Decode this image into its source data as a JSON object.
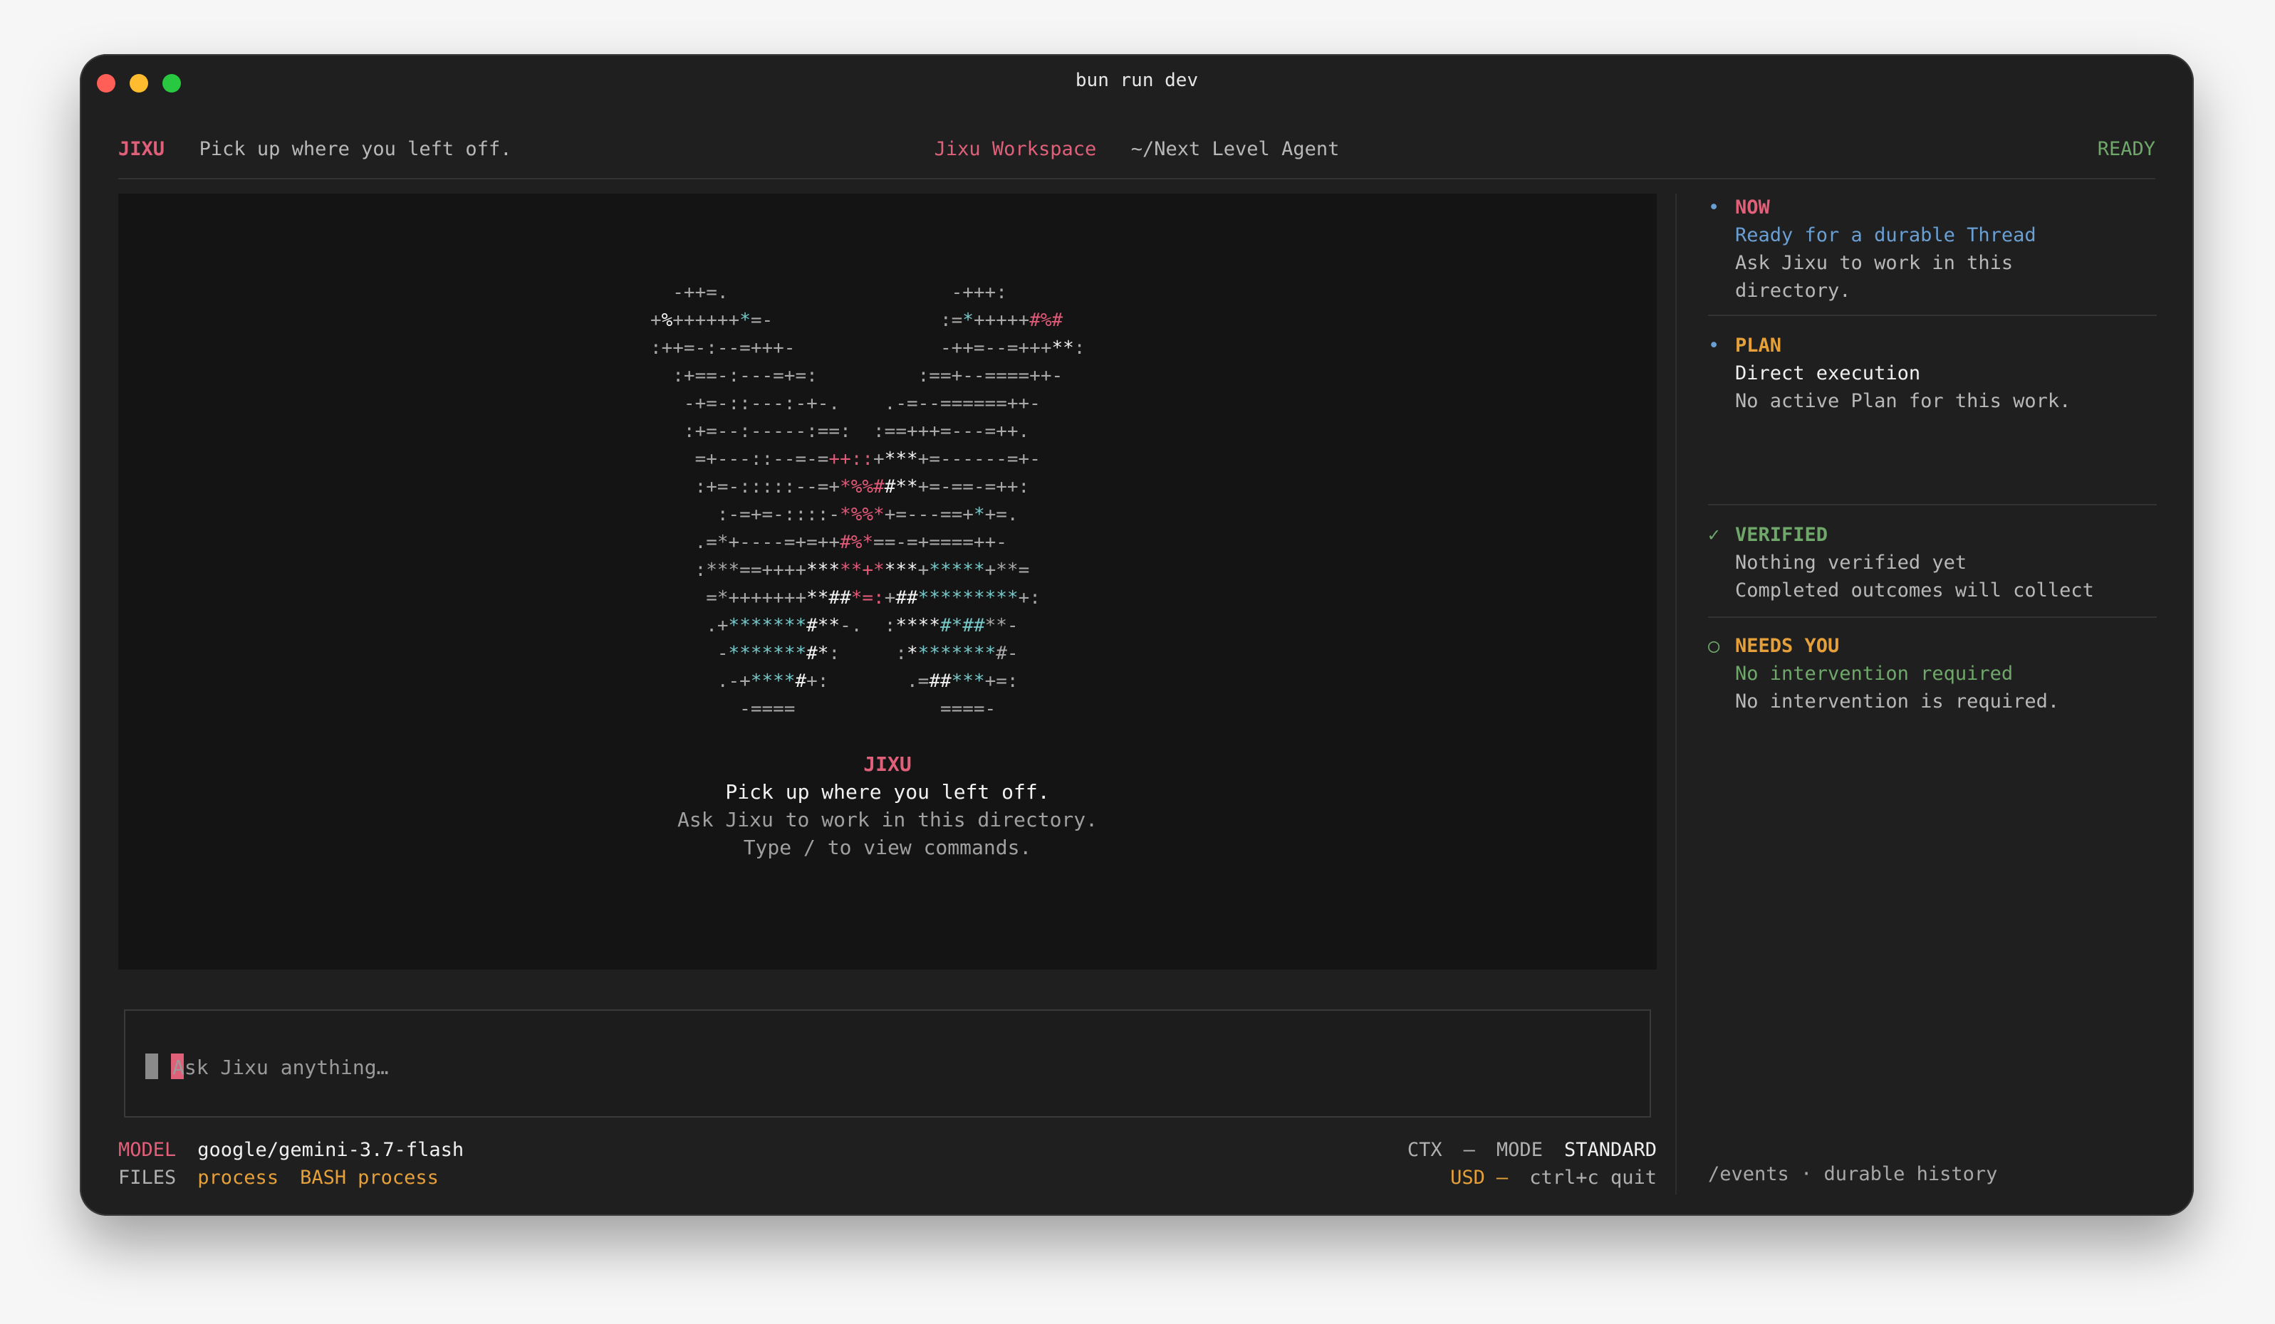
{
  "window": {
    "title": "bun run dev"
  },
  "header": {
    "brand": "JIXU",
    "tagline": "Pick up where you left off.",
    "workspace": "Jixu Workspace",
    "path": "~/Next Level Agent",
    "status": "READY"
  },
  "welcome": {
    "title": "JIXU",
    "subtitle": "Pick up where you left off.",
    "line1": "Ask Jixu to work in this directory.",
    "line2": "Type / to view commands."
  },
  "input": {
    "placeholder": "Ask Jixu anything…"
  },
  "footer": {
    "model_label": "MODEL",
    "model_value": "google/gemini-3.7-flash",
    "files_label": "FILES",
    "files_value": "process",
    "bash_label": "BASH",
    "bash_value": "process",
    "ctx_label": "CTX",
    "ctx_value": "—",
    "mode_label": "MODE",
    "mode_value": "STANDARD",
    "usd_label": "USD",
    "usd_value": "—",
    "quit_hint": "ctrl+c quit"
  },
  "sidebar": {
    "now": {
      "bullet": "•",
      "heading": "NOW",
      "title": "Ready for a durable Thread",
      "desc1": "Ask Jixu to work in this",
      "desc2": "directory."
    },
    "plan": {
      "bullet": "•",
      "heading": "PLAN",
      "title": "Direct execution",
      "desc": "No active Plan for this work."
    },
    "verified": {
      "bullet": "✓",
      "heading": "VERIFIED",
      "line1": "Nothing verified yet",
      "line2": "Completed outcomes will collect"
    },
    "needs_you": {
      "bullet": "○",
      "heading": "NEEDS YOU",
      "title": "No intervention required",
      "desc": "No intervention is required."
    },
    "footer_link": "/events · durable history"
  },
  "colors": {
    "accent_pink": "#e0607a",
    "accent_orange": "#e5a03a",
    "accent_green": "#6fa86a",
    "accent_blue": "#6a9fd4",
    "ascii_cyan": "#76c7c8"
  }
}
